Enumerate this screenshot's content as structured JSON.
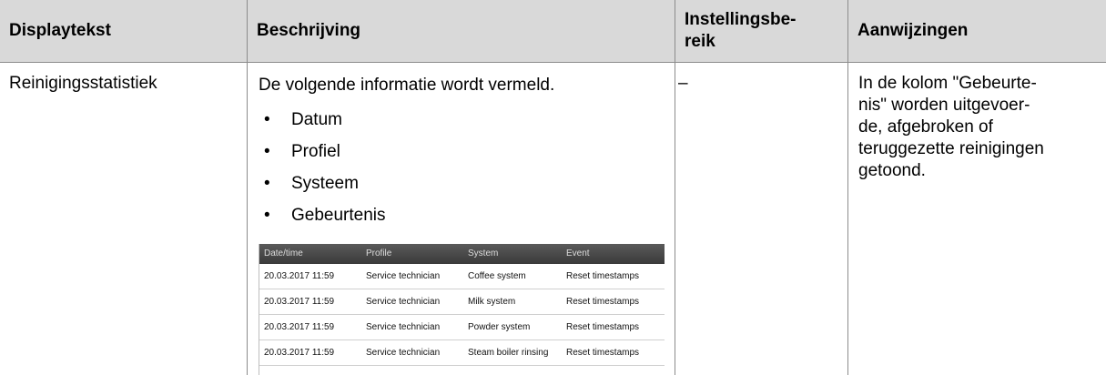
{
  "headers": {
    "col1": "Displaytekst",
    "col2": "Beschrijving",
    "col3": "Instellingsbe-\nreik",
    "col4": "Aanwijzingen"
  },
  "row": {
    "displaytext": "Reinigingsstatistiek",
    "intro": "De volgende informatie wordt vermeld.",
    "bullet_char": "•",
    "bullets": [
      "Datum",
      "Profiel",
      "Systeem",
      "Gebeurtenis"
    ],
    "range": "–",
    "notes": "In de kolom \"Gebeurte-\nnis\" worden uitgevoer-\nde, afgebroken of\nteruggezette reinigingen\ngetoond."
  },
  "screenshot": {
    "headers": [
      "Date/time",
      "Profile",
      "System",
      "Event"
    ],
    "rows": [
      [
        "20.03.2017 11:59",
        "Service technician",
        "Coffee system",
        "Reset timestamps"
      ],
      [
        "20.03.2017 11:59",
        "Service technician",
        "Milk system",
        "Reset timestamps"
      ],
      [
        "20.03.2017 11:59",
        "Service technician",
        "Powder system",
        "Reset timestamps"
      ],
      [
        "20.03.2017 11:59",
        "Service technician",
        "Steam boiler rinsing",
        "Reset timestamps"
      ]
    ]
  }
}
